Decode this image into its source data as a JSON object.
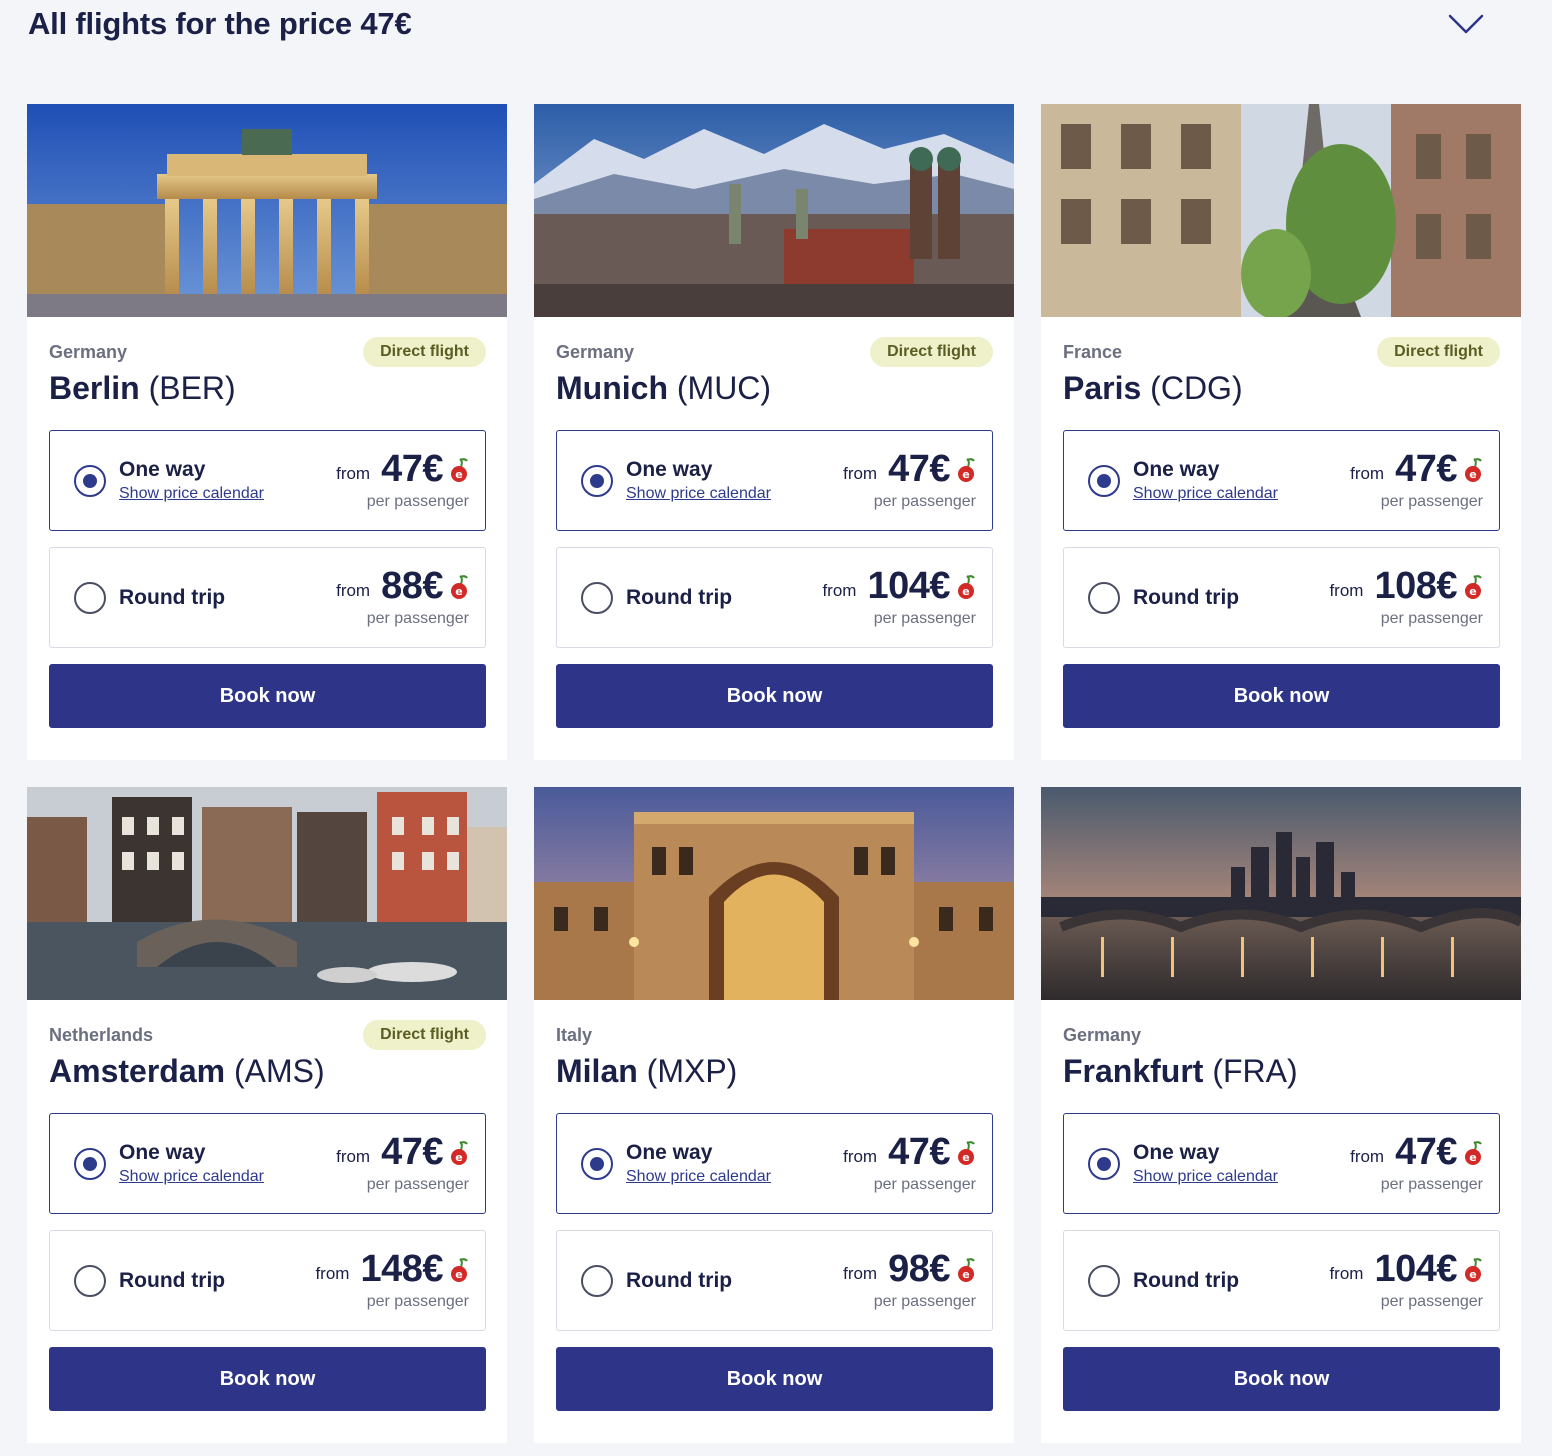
{
  "header": {
    "title": "All flights for the price 47€",
    "toggle_icon": "chevron-down-icon"
  },
  "colors": {
    "accent": "#2e3589",
    "badge_bg": "#eef1c9",
    "text": "#1b2047",
    "muted": "#6b6f80"
  },
  "cards": [
    {
      "country": "Germany",
      "badge": "Direct flight",
      "city": "Berlin",
      "code": "(BER)",
      "image": "brandenburg-gate-photo",
      "one_way": {
        "label": "One way",
        "link": "Show price calendar",
        "from": "from",
        "price": "47€",
        "per": "per passenger"
      },
      "round_trip": {
        "label": "Round trip",
        "from": "from",
        "price": "88€",
        "per": "per passenger"
      },
      "button": "Book now"
    },
    {
      "country": "Germany",
      "badge": "Direct flight",
      "city": "Munich",
      "code": "(MUC)",
      "image": "munich-alps-photo",
      "one_way": {
        "label": "One way",
        "link": "Show price calendar",
        "from": "from",
        "price": "47€",
        "per": "per passenger"
      },
      "round_trip": {
        "label": "Round trip",
        "from": "from",
        "price": "104€",
        "per": "per passenger"
      },
      "button": "Book now"
    },
    {
      "country": "France",
      "badge": "Direct flight",
      "city": "Paris",
      "code": "(CDG)",
      "image": "eiffel-tower-street-photo",
      "one_way": {
        "label": "One way",
        "link": "Show price calendar",
        "from": "from",
        "price": "47€",
        "per": "per passenger"
      },
      "round_trip": {
        "label": "Round trip",
        "from": "from",
        "price": "108€",
        "per": "per passenger"
      },
      "button": "Book now"
    },
    {
      "country": "Netherlands",
      "badge": "Direct flight",
      "city": "Amsterdam",
      "code": "(AMS)",
      "image": "amsterdam-canal-photo",
      "one_way": {
        "label": "One way",
        "link": "Show price calendar",
        "from": "from",
        "price": "47€",
        "per": "per passenger"
      },
      "round_trip": {
        "label": "Round trip",
        "from": "from",
        "price": "148€",
        "per": "per passenger"
      },
      "button": "Book now"
    },
    {
      "country": "Italy",
      "badge": "",
      "city": "Milan",
      "code": "(MXP)",
      "image": "milan-galleria-photo",
      "one_way": {
        "label": "One way",
        "link": "Show price calendar",
        "from": "from",
        "price": "47€",
        "per": "per passenger"
      },
      "round_trip": {
        "label": "Round trip",
        "from": "from",
        "price": "98€",
        "per": "per passenger"
      },
      "button": "Book now"
    },
    {
      "country": "Germany",
      "badge": "",
      "city": "Frankfurt",
      "code": "(FRA)",
      "image": "frankfurt-skyline-photo",
      "one_way": {
        "label": "One way",
        "link": "Show price calendar",
        "from": "from",
        "price": "47€",
        "per": "per passenger"
      },
      "round_trip": {
        "label": "Round trip",
        "from": "from",
        "price": "104€",
        "per": "per passenger"
      },
      "button": "Book now"
    }
  ]
}
